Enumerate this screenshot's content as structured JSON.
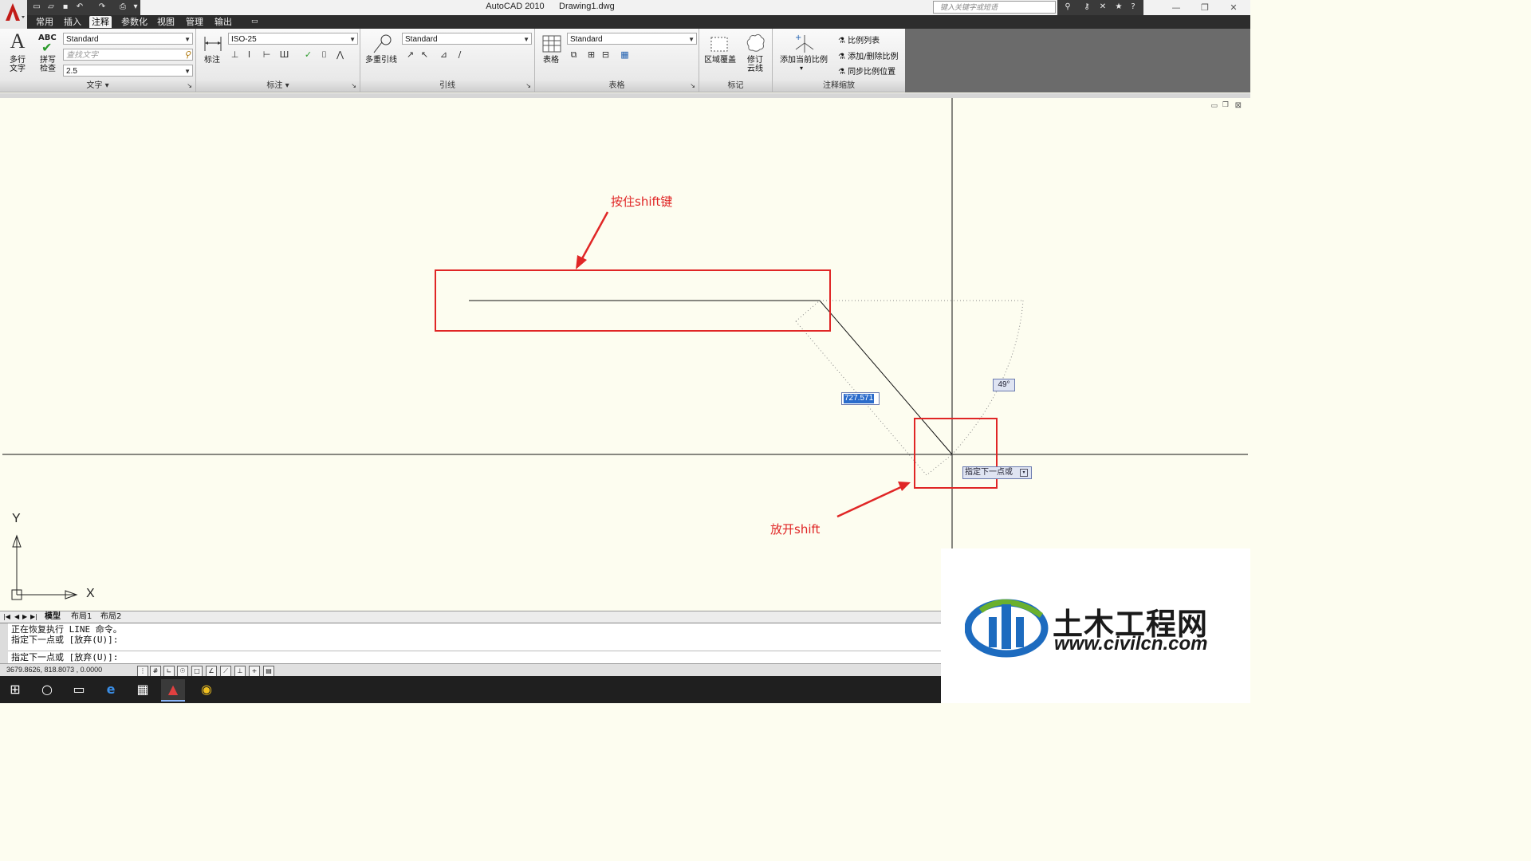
{
  "window": {
    "app_title": "AutoCAD 2010",
    "file_title": "Drawing1.dwg",
    "search_placeholder": "键入关键字或短语"
  },
  "menu_tabs": [
    "常用",
    "插入",
    "注释",
    "参数化",
    "视图",
    "管理",
    "输出"
  ],
  "active_tab": "注释",
  "ribbon": {
    "text_panel": {
      "title": "文字",
      "mtext_label_1": "多行",
      "mtext_label_2": "文字",
      "spell_label_1": "拼写",
      "spell_label_2": "检查",
      "spell_icon_text": "ABC",
      "text_style": "Standard",
      "find_placeholder": "查找文字",
      "text_height": "2.5"
    },
    "dim_panel": {
      "title": "标注",
      "dim_label": "标注",
      "dim_style": "ISO-25"
    },
    "leader_panel": {
      "title": "引线",
      "mleader_label": "多重引线",
      "leader_style": "Standard"
    },
    "table_panel": {
      "title": "表格",
      "table_label": "表格",
      "table_style": "Standard"
    },
    "markup_panel": {
      "title": "标记",
      "wipeout_label": "区域覆盖",
      "revcloud_label_1": "修订",
      "revcloud_label_2": "云线"
    },
    "scale_panel": {
      "title": "注释缩放",
      "add_scale_label": "添加当前比例",
      "scale_list": "比例列表",
      "add_delete_scale": "添加/删除比例",
      "sync_scale": "同步比例位置"
    }
  },
  "drawing": {
    "length_input": "727.571",
    "angle_tooltip": "49°",
    "prompt_tooltip": "指定下一点或",
    "ucs_x": "X",
    "ucs_y": "Y"
  },
  "annotations": {
    "hold_shift": "按住shift键",
    "release_shift": "放开shift"
  },
  "layout_tabs": [
    "模型",
    "布局1",
    "布局2"
  ],
  "command_lines": [
    "正在恢复执行 LINE 命令。",
    "指定下一点或 [放弃(U)]:",
    "指定下一点或 [放弃(U)]:"
  ],
  "status": {
    "coordinates": "3679.8626, 818.8073 , 0.0000"
  },
  "watermark": {
    "brand": "土木工程网",
    "url": "www.civilcn.com"
  },
  "colors": {
    "annotation_red": "#e02626",
    "canvas_bg": "#fdfdf0",
    "ribbon_dark": "#2d2d2d"
  }
}
